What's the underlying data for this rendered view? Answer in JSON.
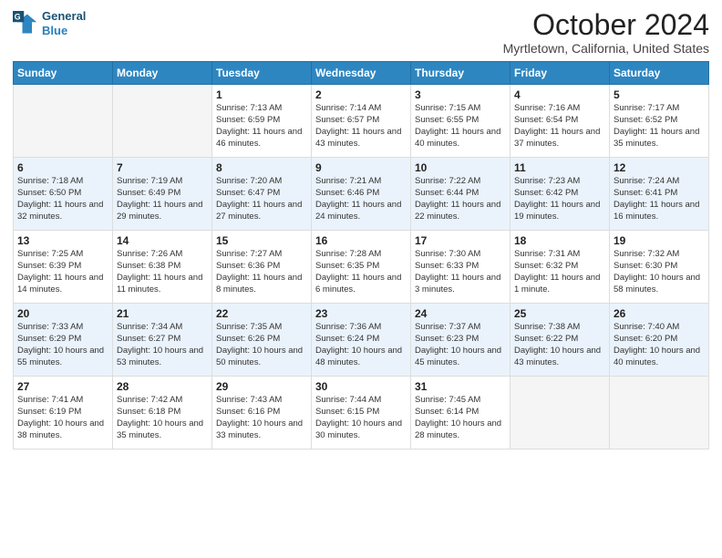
{
  "logo": {
    "line1": "General",
    "line2": "Blue"
  },
  "title": "October 2024",
  "subtitle": "Myrtletown, California, United States",
  "days_of_week": [
    "Sunday",
    "Monday",
    "Tuesday",
    "Wednesday",
    "Thursday",
    "Friday",
    "Saturday"
  ],
  "weeks": [
    [
      {
        "num": "",
        "sunrise": "",
        "sunset": "",
        "daylight": ""
      },
      {
        "num": "",
        "sunrise": "",
        "sunset": "",
        "daylight": ""
      },
      {
        "num": "1",
        "sunrise": "Sunrise: 7:13 AM",
        "sunset": "Sunset: 6:59 PM",
        "daylight": "Daylight: 11 hours and 46 minutes."
      },
      {
        "num": "2",
        "sunrise": "Sunrise: 7:14 AM",
        "sunset": "Sunset: 6:57 PM",
        "daylight": "Daylight: 11 hours and 43 minutes."
      },
      {
        "num": "3",
        "sunrise": "Sunrise: 7:15 AM",
        "sunset": "Sunset: 6:55 PM",
        "daylight": "Daylight: 11 hours and 40 minutes."
      },
      {
        "num": "4",
        "sunrise": "Sunrise: 7:16 AM",
        "sunset": "Sunset: 6:54 PM",
        "daylight": "Daylight: 11 hours and 37 minutes."
      },
      {
        "num": "5",
        "sunrise": "Sunrise: 7:17 AM",
        "sunset": "Sunset: 6:52 PM",
        "daylight": "Daylight: 11 hours and 35 minutes."
      }
    ],
    [
      {
        "num": "6",
        "sunrise": "Sunrise: 7:18 AM",
        "sunset": "Sunset: 6:50 PM",
        "daylight": "Daylight: 11 hours and 32 minutes."
      },
      {
        "num": "7",
        "sunrise": "Sunrise: 7:19 AM",
        "sunset": "Sunset: 6:49 PM",
        "daylight": "Daylight: 11 hours and 29 minutes."
      },
      {
        "num": "8",
        "sunrise": "Sunrise: 7:20 AM",
        "sunset": "Sunset: 6:47 PM",
        "daylight": "Daylight: 11 hours and 27 minutes."
      },
      {
        "num": "9",
        "sunrise": "Sunrise: 7:21 AM",
        "sunset": "Sunset: 6:46 PM",
        "daylight": "Daylight: 11 hours and 24 minutes."
      },
      {
        "num": "10",
        "sunrise": "Sunrise: 7:22 AM",
        "sunset": "Sunset: 6:44 PM",
        "daylight": "Daylight: 11 hours and 22 minutes."
      },
      {
        "num": "11",
        "sunrise": "Sunrise: 7:23 AM",
        "sunset": "Sunset: 6:42 PM",
        "daylight": "Daylight: 11 hours and 19 minutes."
      },
      {
        "num": "12",
        "sunrise": "Sunrise: 7:24 AM",
        "sunset": "Sunset: 6:41 PM",
        "daylight": "Daylight: 11 hours and 16 minutes."
      }
    ],
    [
      {
        "num": "13",
        "sunrise": "Sunrise: 7:25 AM",
        "sunset": "Sunset: 6:39 PM",
        "daylight": "Daylight: 11 hours and 14 minutes."
      },
      {
        "num": "14",
        "sunrise": "Sunrise: 7:26 AM",
        "sunset": "Sunset: 6:38 PM",
        "daylight": "Daylight: 11 hours and 11 minutes."
      },
      {
        "num": "15",
        "sunrise": "Sunrise: 7:27 AM",
        "sunset": "Sunset: 6:36 PM",
        "daylight": "Daylight: 11 hours and 8 minutes."
      },
      {
        "num": "16",
        "sunrise": "Sunrise: 7:28 AM",
        "sunset": "Sunset: 6:35 PM",
        "daylight": "Daylight: 11 hours and 6 minutes."
      },
      {
        "num": "17",
        "sunrise": "Sunrise: 7:30 AM",
        "sunset": "Sunset: 6:33 PM",
        "daylight": "Daylight: 11 hours and 3 minutes."
      },
      {
        "num": "18",
        "sunrise": "Sunrise: 7:31 AM",
        "sunset": "Sunset: 6:32 PM",
        "daylight": "Daylight: 11 hours and 1 minute."
      },
      {
        "num": "19",
        "sunrise": "Sunrise: 7:32 AM",
        "sunset": "Sunset: 6:30 PM",
        "daylight": "Daylight: 10 hours and 58 minutes."
      }
    ],
    [
      {
        "num": "20",
        "sunrise": "Sunrise: 7:33 AM",
        "sunset": "Sunset: 6:29 PM",
        "daylight": "Daylight: 10 hours and 55 minutes."
      },
      {
        "num": "21",
        "sunrise": "Sunrise: 7:34 AM",
        "sunset": "Sunset: 6:27 PM",
        "daylight": "Daylight: 10 hours and 53 minutes."
      },
      {
        "num": "22",
        "sunrise": "Sunrise: 7:35 AM",
        "sunset": "Sunset: 6:26 PM",
        "daylight": "Daylight: 10 hours and 50 minutes."
      },
      {
        "num": "23",
        "sunrise": "Sunrise: 7:36 AM",
        "sunset": "Sunset: 6:24 PM",
        "daylight": "Daylight: 10 hours and 48 minutes."
      },
      {
        "num": "24",
        "sunrise": "Sunrise: 7:37 AM",
        "sunset": "Sunset: 6:23 PM",
        "daylight": "Daylight: 10 hours and 45 minutes."
      },
      {
        "num": "25",
        "sunrise": "Sunrise: 7:38 AM",
        "sunset": "Sunset: 6:22 PM",
        "daylight": "Daylight: 10 hours and 43 minutes."
      },
      {
        "num": "26",
        "sunrise": "Sunrise: 7:40 AM",
        "sunset": "Sunset: 6:20 PM",
        "daylight": "Daylight: 10 hours and 40 minutes."
      }
    ],
    [
      {
        "num": "27",
        "sunrise": "Sunrise: 7:41 AM",
        "sunset": "Sunset: 6:19 PM",
        "daylight": "Daylight: 10 hours and 38 minutes."
      },
      {
        "num": "28",
        "sunrise": "Sunrise: 7:42 AM",
        "sunset": "Sunset: 6:18 PM",
        "daylight": "Daylight: 10 hours and 35 minutes."
      },
      {
        "num": "29",
        "sunrise": "Sunrise: 7:43 AM",
        "sunset": "Sunset: 6:16 PM",
        "daylight": "Daylight: 10 hours and 33 minutes."
      },
      {
        "num": "30",
        "sunrise": "Sunrise: 7:44 AM",
        "sunset": "Sunset: 6:15 PM",
        "daylight": "Daylight: 10 hours and 30 minutes."
      },
      {
        "num": "31",
        "sunrise": "Sunrise: 7:45 AM",
        "sunset": "Sunset: 6:14 PM",
        "daylight": "Daylight: 10 hours and 28 minutes."
      },
      {
        "num": "",
        "sunrise": "",
        "sunset": "",
        "daylight": ""
      },
      {
        "num": "",
        "sunrise": "",
        "sunset": "",
        "daylight": ""
      }
    ]
  ]
}
